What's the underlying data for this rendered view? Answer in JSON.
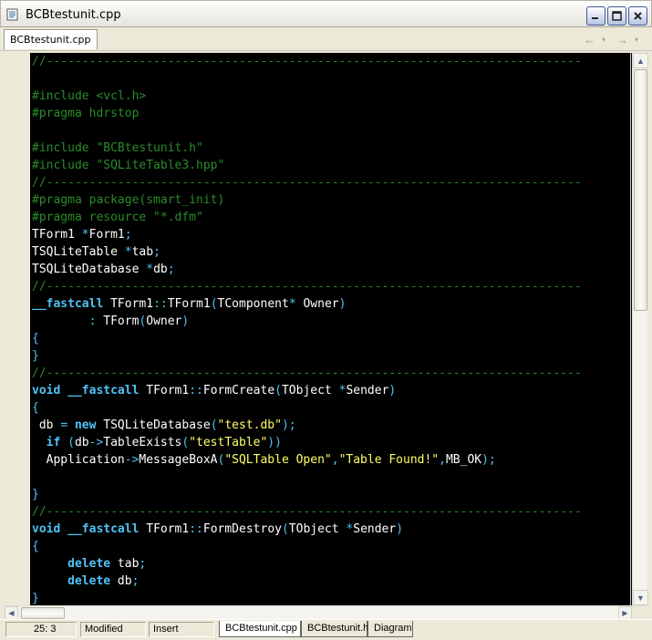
{
  "window": {
    "title": "BCBtestunit.cpp"
  },
  "tabs": {
    "file_tab": "BCBtestunit.cpp"
  },
  "code": {
    "lines": [
      [
        [
          "cmt",
          "//---------------------------------------------------------------------------"
        ]
      ],
      [],
      [
        [
          "cmt",
          "#include <vcl.h>"
        ]
      ],
      [
        [
          "cmt",
          "#pragma hdrstop"
        ]
      ],
      [],
      [
        [
          "cmt",
          "#include \"BCBtestunit.h\""
        ]
      ],
      [
        [
          "cmt",
          "#include \"SQLiteTable3.hpp\""
        ]
      ],
      [
        [
          "cmt",
          "//---------------------------------------------------------------------------"
        ]
      ],
      [
        [
          "cmt",
          "#pragma package(smart_init)"
        ]
      ],
      [
        [
          "cmt",
          "#pragma resource \"*.dfm\""
        ]
      ],
      [
        [
          "txt",
          "TForm1 "
        ],
        [
          "sym",
          "*"
        ],
        [
          "txt",
          "Form1"
        ],
        [
          "sym",
          ";"
        ]
      ],
      [
        [
          "txt",
          "TSQLiteTable "
        ],
        [
          "sym",
          "*"
        ],
        [
          "txt",
          "tab"
        ],
        [
          "sym",
          ";"
        ]
      ],
      [
        [
          "txt",
          "TSQLiteDatabase "
        ],
        [
          "sym",
          "*"
        ],
        [
          "txt",
          "db"
        ],
        [
          "sym",
          ";"
        ]
      ],
      [
        [
          "cmt",
          "//---------------------------------------------------------------------------"
        ]
      ],
      [
        [
          "kw",
          "__fastcall"
        ],
        [
          "txt",
          " TForm1"
        ],
        [
          "sym",
          "::"
        ],
        [
          "txt",
          "TForm1"
        ],
        [
          "sym",
          "("
        ],
        [
          "txt",
          "TComponent"
        ],
        [
          "sym",
          "*"
        ],
        [
          "txt",
          " Owner"
        ],
        [
          "sym",
          ")"
        ]
      ],
      [
        [
          "txt",
          "        "
        ],
        [
          "sym",
          ":"
        ],
        [
          "txt",
          " TForm"
        ],
        [
          "sym",
          "("
        ],
        [
          "txt",
          "Owner"
        ],
        [
          "sym",
          ")"
        ]
      ],
      [
        [
          "sym",
          "{"
        ]
      ],
      [
        [
          "sym",
          "}"
        ]
      ],
      [
        [
          "cmt",
          "//---------------------------------------------------------------------------"
        ]
      ],
      [
        [
          "kw",
          "void"
        ],
        [
          "txt",
          " "
        ],
        [
          "kw",
          "__fastcall"
        ],
        [
          "txt",
          " TForm1"
        ],
        [
          "sym",
          "::"
        ],
        [
          "txt",
          "FormCreate"
        ],
        [
          "sym",
          "("
        ],
        [
          "txt",
          "TObject "
        ],
        [
          "sym",
          "*"
        ],
        [
          "txt",
          "Sender"
        ],
        [
          "sym",
          ")"
        ]
      ],
      [
        [
          "sym",
          "{"
        ]
      ],
      [
        [
          "txt",
          " db "
        ],
        [
          "sym",
          "="
        ],
        [
          "txt",
          " "
        ],
        [
          "kw",
          "new"
        ],
        [
          "txt",
          " TSQLiteDatabase"
        ],
        [
          "sym",
          "("
        ],
        [
          "str",
          "\"test.db\""
        ],
        [
          "sym",
          ");"
        ]
      ],
      [
        [
          "txt",
          "  "
        ],
        [
          "kw",
          "if"
        ],
        [
          "txt",
          " "
        ],
        [
          "sym",
          "("
        ],
        [
          "txt",
          "db"
        ],
        [
          "sym",
          "->"
        ],
        [
          "txt",
          "TableExists"
        ],
        [
          "sym",
          "("
        ],
        [
          "str",
          "\"testTable\""
        ],
        [
          "sym",
          "))"
        ]
      ],
      [
        [
          "txt",
          "  Application"
        ],
        [
          "sym",
          "->"
        ],
        [
          "txt",
          "MessageBoxA"
        ],
        [
          "sym",
          "("
        ],
        [
          "str",
          "\"SQLTable Open\""
        ],
        [
          "sym",
          ","
        ],
        [
          "str",
          "\"Table Found!\""
        ],
        [
          "sym",
          ","
        ],
        [
          "txt",
          "MB_OK"
        ],
        [
          "sym",
          ");"
        ]
      ],
      [],
      [
        [
          "sym",
          "}"
        ]
      ],
      [
        [
          "cmt",
          "//---------------------------------------------------------------------------"
        ]
      ],
      [
        [
          "kw",
          "void"
        ],
        [
          "txt",
          " "
        ],
        [
          "kw",
          "__fastcall"
        ],
        [
          "txt",
          " TForm1"
        ],
        [
          "sym",
          "::"
        ],
        [
          "txt",
          "FormDestroy"
        ],
        [
          "sym",
          "("
        ],
        [
          "txt",
          "TObject "
        ],
        [
          "sym",
          "*"
        ],
        [
          "txt",
          "Sender"
        ],
        [
          "sym",
          ")"
        ]
      ],
      [
        [
          "sym",
          "{"
        ]
      ],
      [
        [
          "txt",
          "     "
        ],
        [
          "kw",
          "delete"
        ],
        [
          "txt",
          " tab"
        ],
        [
          "sym",
          ";"
        ]
      ],
      [
        [
          "txt",
          "     "
        ],
        [
          "kw",
          "delete"
        ],
        [
          "txt",
          " db"
        ],
        [
          "sym",
          ";"
        ]
      ],
      [
        [
          "sym",
          "}"
        ]
      ]
    ]
  },
  "status": {
    "position": "25:  3",
    "modified": "Modified",
    "mode": "Insert"
  },
  "bottom_tabs": [
    "BCBtestunit.cpp",
    "BCBtestunit.h",
    "Diagram"
  ],
  "colors": {
    "background": "#000000",
    "comment": "#2a8c2a",
    "keyword": "#4fc3f7",
    "string": "#ffff66",
    "text": "#ffffff"
  },
  "icons": {
    "app": "document-icon",
    "minimize": "minimize-icon",
    "maximize": "maximize-icon",
    "close": "close-icon",
    "back": "arrow-left-icon",
    "forward": "arrow-right-icon"
  }
}
